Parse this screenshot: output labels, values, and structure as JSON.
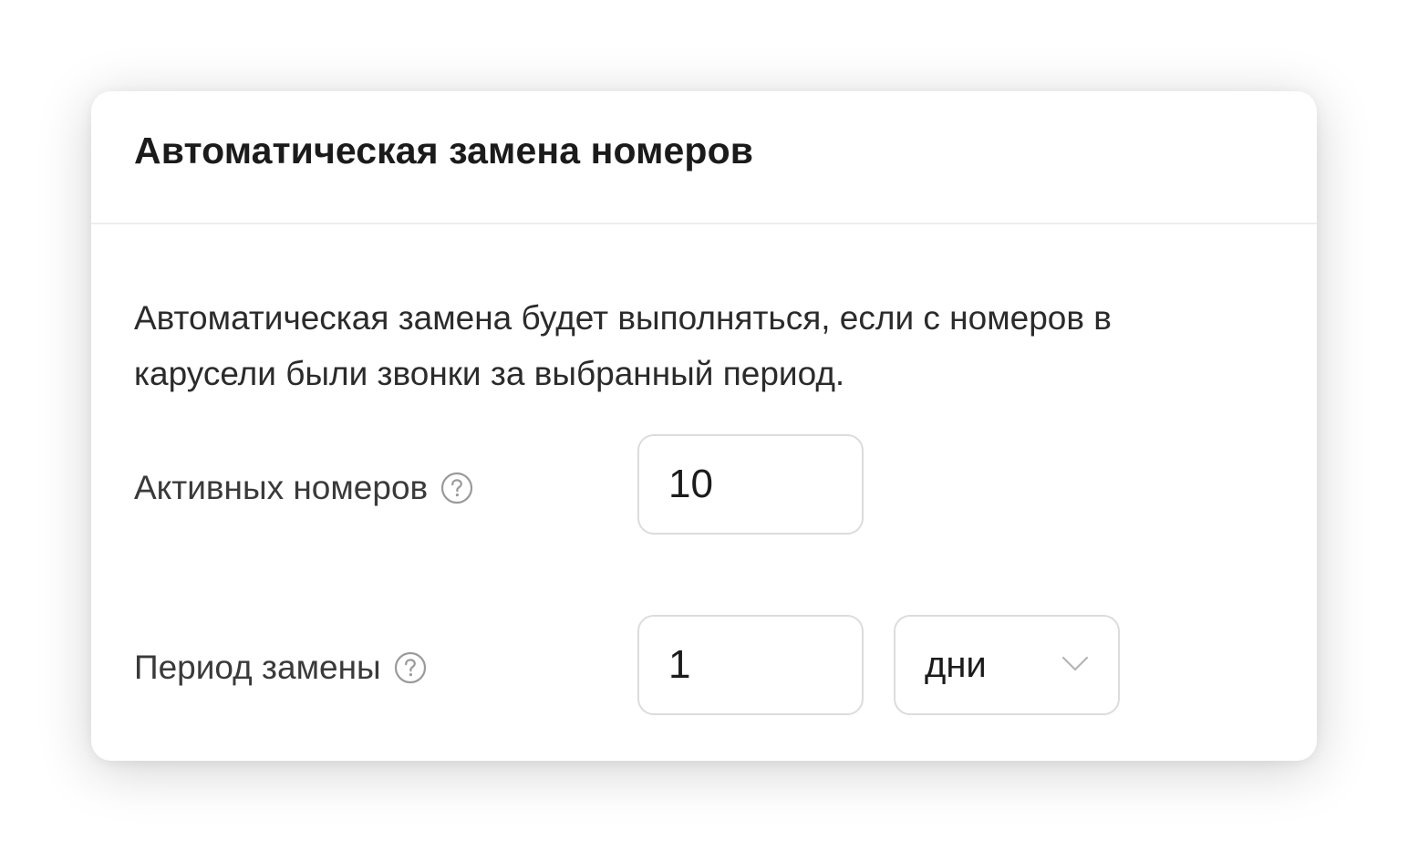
{
  "card": {
    "title": "Автоматическая замена номеров",
    "description": "Автоматическая замена будет выполняться, если с номеров в карусели были звонки за выбранный период."
  },
  "active_numbers": {
    "label": "Активных номеров",
    "value": "10",
    "help_icon": "question-circle-icon"
  },
  "replacement_period": {
    "label": "Период замены",
    "value": "1",
    "unit_selected": "дни",
    "help_icon": "question-circle-icon",
    "dropdown_icon": "chevron-down-icon"
  },
  "colors": {
    "background": "#ffffff",
    "border": "#dcdcdc",
    "divider": "#ededed",
    "text": "#1b1b1b",
    "icon": "#9a9a9a"
  }
}
